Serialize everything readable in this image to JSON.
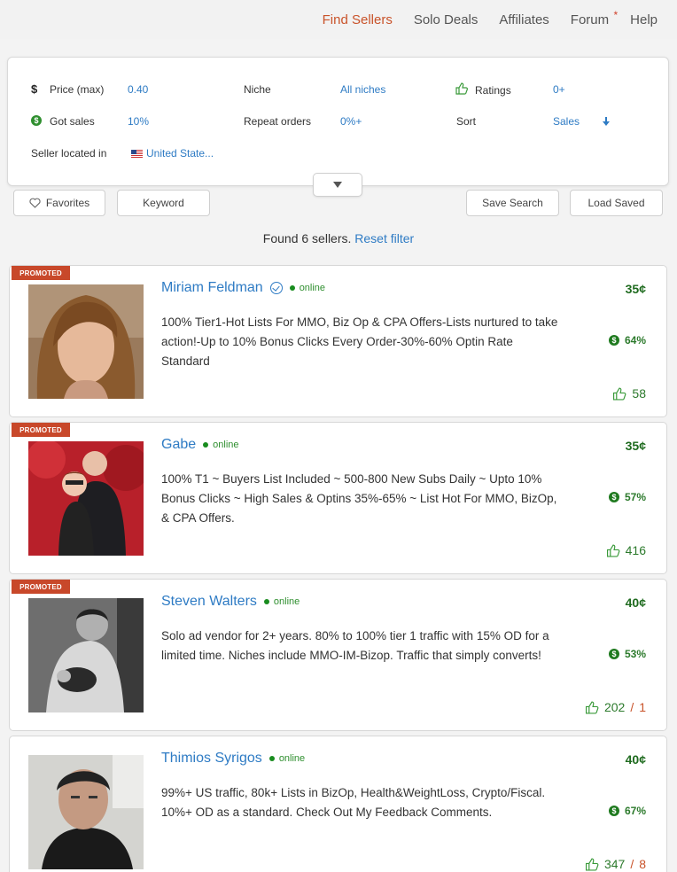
{
  "nav": {
    "items": [
      "Find Sellers",
      "Solo Deals",
      "Affiliates",
      "Forum",
      "Help"
    ],
    "forum_badge": "*"
  },
  "filters": {
    "price_label": "Price (max)",
    "price_value": "0.40",
    "niche_label": "Niche",
    "niche_value": "All niches",
    "ratings_label": "Ratings",
    "ratings_value": "0+",
    "got_sales_label": "Got sales",
    "got_sales_value": "10%",
    "repeat_label": "Repeat orders",
    "repeat_value": "0%+",
    "sort_label": "Sort",
    "sort_value": "Sales",
    "location_label": "Seller located in",
    "location_value": "United State..."
  },
  "buttons": {
    "favorites": "Favorites",
    "keyword": "Keyword",
    "save_search": "Save Search",
    "load_saved": "Load Saved"
  },
  "results": {
    "found_text": "Found 6 sellers.",
    "reset_text": "Reset filter"
  },
  "colors": {
    "accent": "#c9532a",
    "link": "#2e7bc4",
    "green": "#1f6b1f",
    "promo": "#c8482a"
  },
  "sellers": [
    {
      "promoted": "PROMOTED",
      "name": "Miriam Feldman",
      "verified": true,
      "status": "online",
      "description": "100% Tier1-Hot Lists For MMO, Biz Op & CPA Offers-Lists nurtured to take action!-Up to 10% Bonus Clicks Every Order-30%-60% Optin Rate Standard",
      "price": "35¢",
      "sales": "64%",
      "likes": "58",
      "dislikes": ""
    },
    {
      "promoted": "PROMOTED",
      "name": "Gabe",
      "verified": false,
      "status": "online",
      "description": "100% T1 ~ Buyers List Included ~ 500-800 New Subs Daily ~ Upto 10% Bonus Clicks ~ High Sales & Optins 35%-65% ~ List Hot For MMO, BizOp, & CPA Offers.",
      "price": "35¢",
      "sales": "57%",
      "likes": "416",
      "dislikes": ""
    },
    {
      "promoted": "PROMOTED",
      "name": "Steven Walters",
      "verified": false,
      "status": "online",
      "description": "Solo ad vendor for 2+ years. 80% to 100% tier 1 traffic with 15% OD for a limited time. Niches include MMO-IM-Bizop. Traffic that simply converts!",
      "price": "40¢",
      "sales": "53%",
      "likes": "202",
      "dislikes": "1"
    },
    {
      "promoted": "",
      "name": "Thimios Syrigos",
      "verified": false,
      "status": "online",
      "description": "99%+ US traffic, 80k+ Lists in BizOp, Health&WeightLoss, Crypto/Fiscal. 10%+ OD as a standard. Check Out My Feedback Comments.",
      "price": "40¢",
      "sales": "67%",
      "likes": "347",
      "dislikes": "8"
    }
  ]
}
